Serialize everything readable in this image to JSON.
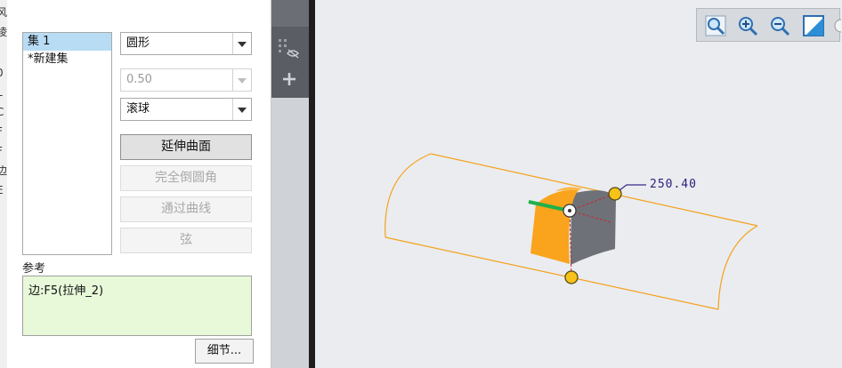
{
  "left_panel": {
    "sets": [
      {
        "label": "集 1",
        "selected": true
      },
      {
        "label": "*新建集",
        "selected": false
      }
    ],
    "shape_select": {
      "value": "圆形"
    },
    "radius_select": {
      "value": "0.50"
    },
    "type_select": {
      "value": "滚球"
    },
    "buttons": {
      "extend_surface": "延伸曲面",
      "full_round": "完全倒圆角",
      "through_curve": "通过曲线",
      "chord": "弦"
    },
    "references": {
      "label": "参考",
      "value": "边:F5(拉伸_2)"
    },
    "details_button": "细节..."
  },
  "left_strip_chars": [
    "风",
    "棱",
    "",
    "0",
    "L",
    "C",
    "F",
    "F",
    "边",
    "E"
  ],
  "viewport": {
    "dimension_label": "250.40",
    "toolbar_icons": [
      "zoom-fit-icon",
      "zoom-in-icon",
      "zoom-out-icon",
      "repaint-icon"
    ]
  },
  "colors": {
    "selection": "#b9dcf5",
    "reference_bg": "#e8f9d9",
    "model_orange": "#f9a41c",
    "handle_yellow": "#f7c21a",
    "axis_green": "#22b04a"
  }
}
